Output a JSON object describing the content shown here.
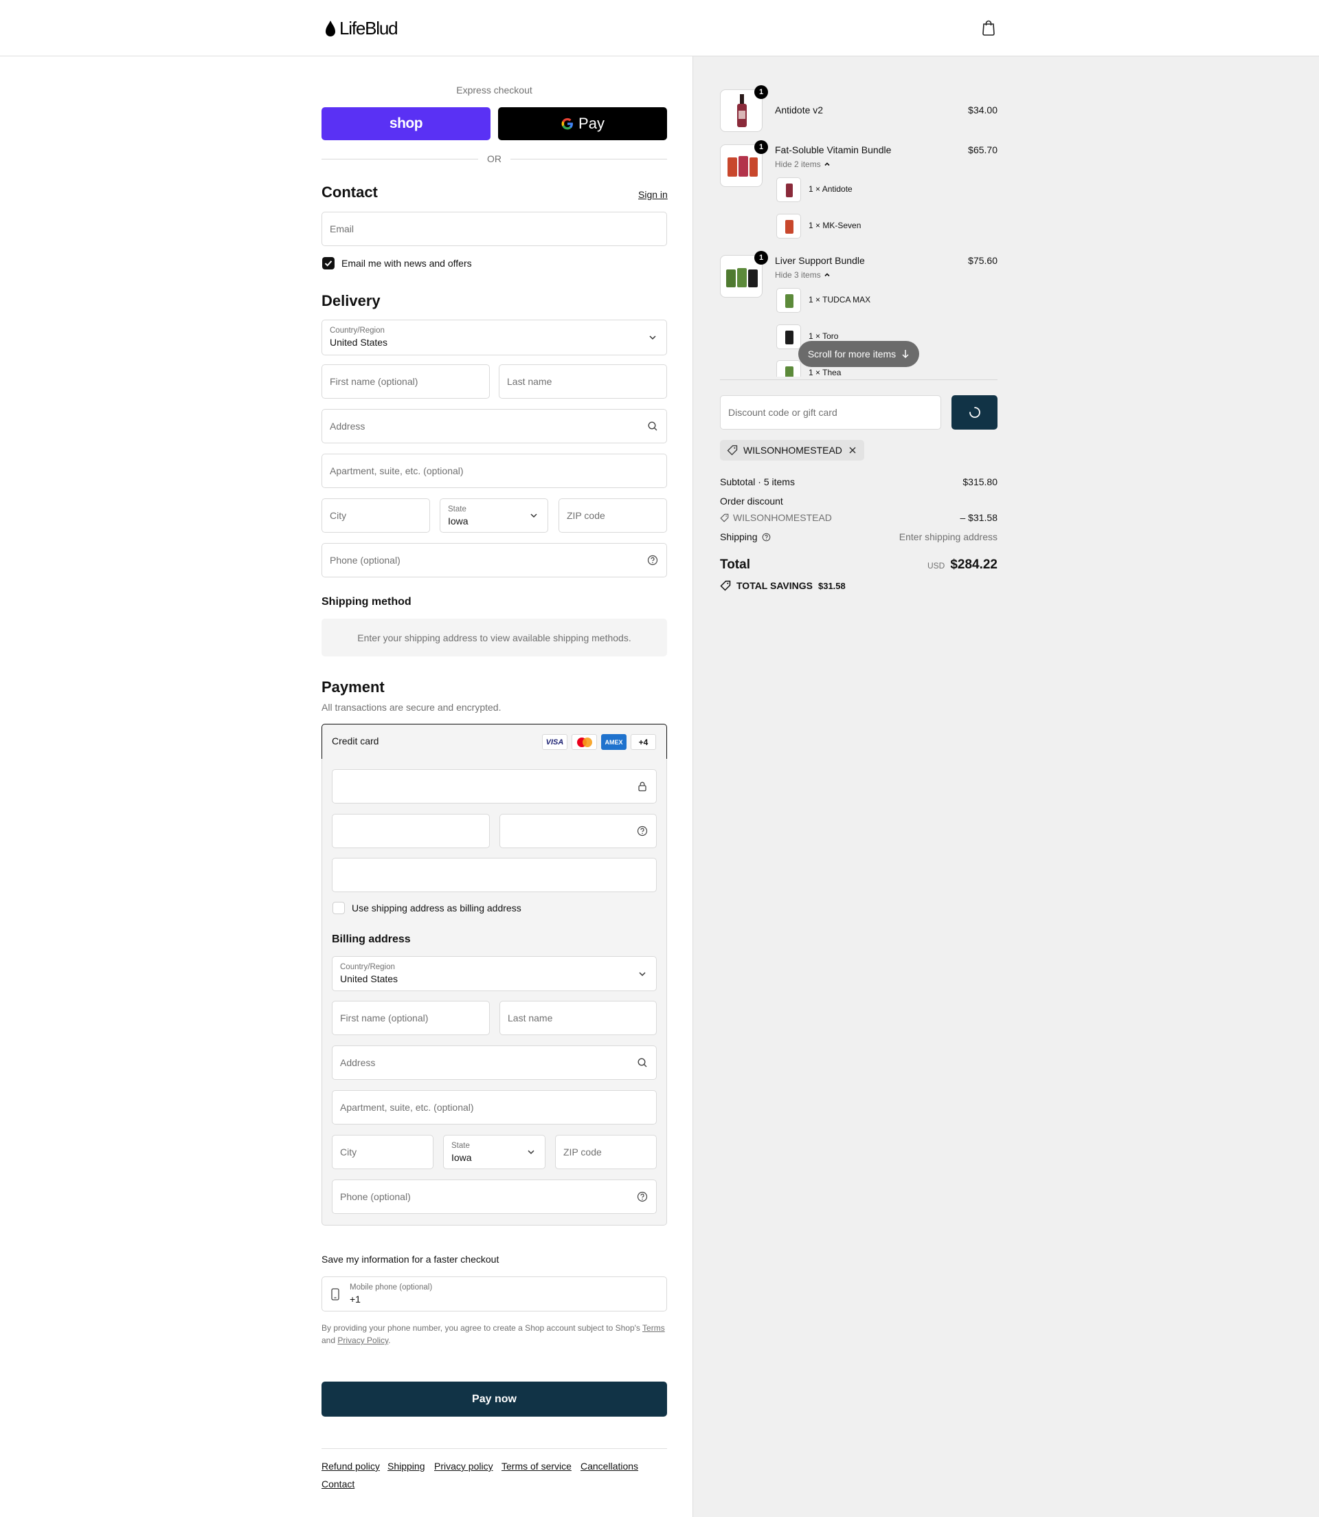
{
  "header": {
    "brand": "LifeBlud"
  },
  "express": {
    "title": "Express checkout",
    "shop_label": "shop",
    "gpay_label": "Pay",
    "or_label": "OR"
  },
  "contact": {
    "title": "Contact",
    "sign_in": "Sign in",
    "email_placeholder": "Email",
    "news_label": "Email me with news and offers",
    "news_checked": true
  },
  "delivery": {
    "title": "Delivery",
    "country_label": "Country/Region",
    "country_value": "United States",
    "first_name": "First name (optional)",
    "last_name": "Last name",
    "address": "Address",
    "apartment": "Apartment, suite, etc. (optional)",
    "city": "City",
    "state_label": "State",
    "state_value": "Iowa",
    "zip": "ZIP code",
    "phone": "Phone (optional)"
  },
  "shipping_method": {
    "title": "Shipping method",
    "message": "Enter your shipping address to view available shipping methods."
  },
  "payment": {
    "title": "Payment",
    "subtitle": "All transactions are secure and encrypted.",
    "credit_card": "Credit card",
    "more_cards": "+4",
    "card_logos": [
      "VISA",
      "mastercard",
      "AMEX"
    ],
    "use_shipping": "Use shipping address as billing address",
    "use_shipping_checked": false
  },
  "billing": {
    "title": "Billing address",
    "country_label": "Country/Region",
    "country_value": "United States",
    "first_name": "First name (optional)",
    "last_name": "Last name",
    "address": "Address",
    "apartment": "Apartment, suite, etc. (optional)",
    "city": "City",
    "state_label": "State",
    "state_value": "Iowa",
    "zip": "ZIP code",
    "phone": "Phone (optional)"
  },
  "save_info": {
    "title": "Save my information for a faster checkout",
    "mobile_label": "Mobile phone (optional)",
    "mobile_value": "+1",
    "legal_prefix": "By providing your phone number, you agree to create a Shop account subject to Shop's",
    "terms": "Terms",
    "and": "and",
    "privacy": "Privacy Policy",
    "period": "."
  },
  "pay_now": "Pay now",
  "footer": {
    "links": [
      "Refund policy",
      "Shipping",
      "Privacy policy",
      "Terms of service",
      "Cancellations",
      "Contact"
    ]
  },
  "cart": {
    "items": [
      {
        "name": "Antidote v2",
        "price": "$34.00",
        "qty": "1"
      },
      {
        "name": "Fat-Soluble Vitamin Bundle",
        "price": "$65.70",
        "qty": "1",
        "toggle": "Hide 2 items",
        "sub": [
          "1 × Antidote",
          "1 × MK-Seven"
        ]
      },
      {
        "name": "Liver Support Bundle",
        "price": "$75.60",
        "qty": "1",
        "toggle": "Hide 3 items",
        "sub": [
          "1 × TUDCA MAX",
          "1 × Toro",
          "1 × Thea"
        ]
      }
    ],
    "scroll_hint": "Scroll for more items"
  },
  "discount": {
    "placeholder": "Discount code or gift card",
    "code": "WILSONHOMESTEAD"
  },
  "summary": {
    "subtotal_label": "Subtotal · 5 items",
    "subtotal_value": "$315.80",
    "order_discount_label": "Order discount",
    "discount_code": "WILSONHOMESTEAD",
    "discount_value": "– $31.58",
    "shipping_label": "Shipping",
    "shipping_value": "Enter shipping address",
    "total_label": "Total",
    "currency": "USD",
    "total_value": "$284.22",
    "savings_label": "TOTAL SAVINGS",
    "savings_value": "$31.58"
  },
  "colors": {
    "shop_purple": "#5a31f4",
    "primary_dark": "#113346",
    "panel_bg": "#f0f0f0"
  }
}
